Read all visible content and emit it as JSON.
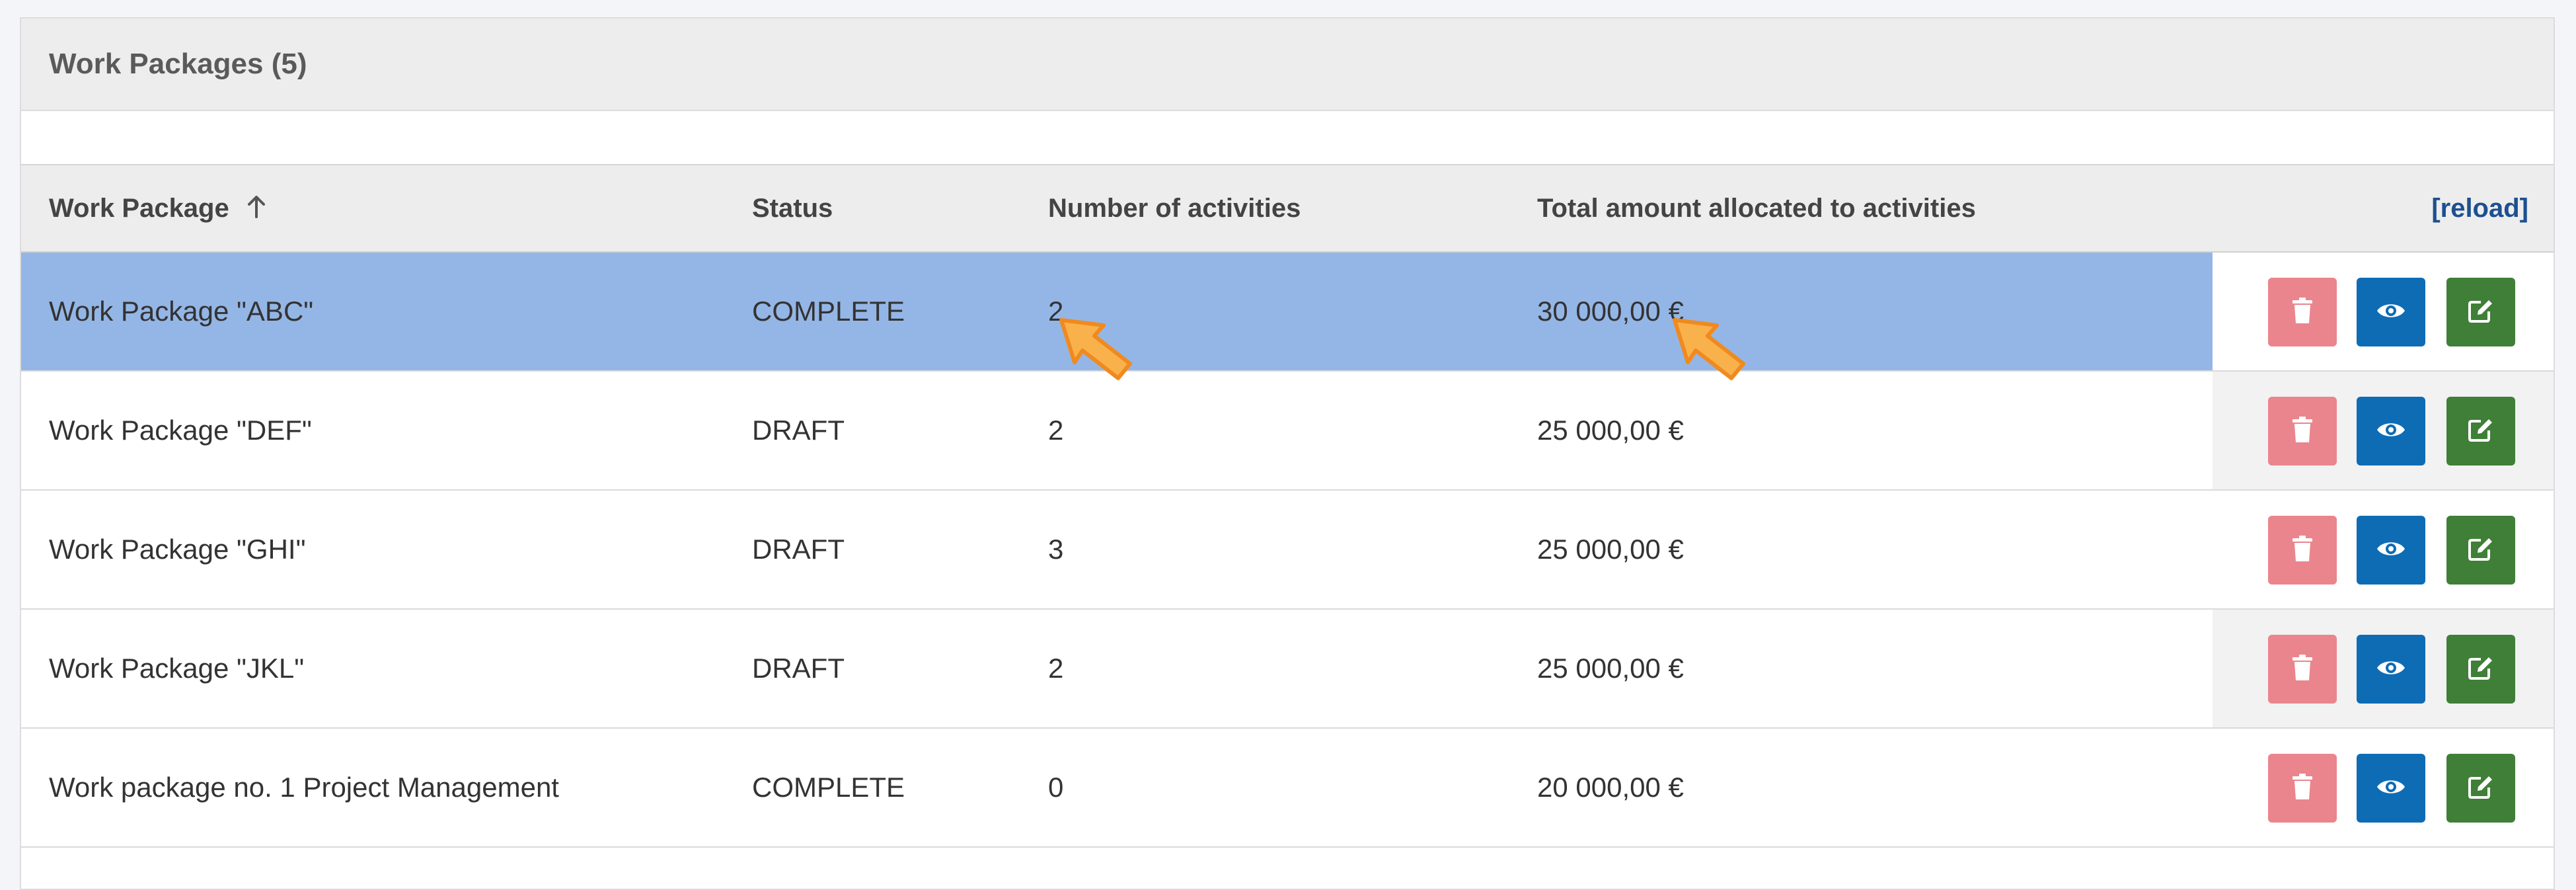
{
  "panel": {
    "title": "Work Packages (5)"
  },
  "table": {
    "headers": {
      "work_package": "Work Package",
      "status": "Status",
      "activities": "Number of activities",
      "amount": "Total amount allocated to activities"
    },
    "sort_icon": "arrow-up-icon",
    "reload_label": "[reload]",
    "rows": [
      {
        "name": "Work Package \"ABC\"",
        "status": "COMPLETE",
        "activities": "2",
        "amount": "30 000,00 €",
        "selected": true
      },
      {
        "name": "Work Package \"DEF\"",
        "status": "DRAFT",
        "activities": "2",
        "amount": "25 000,00 €",
        "selected": false
      },
      {
        "name": "Work Package \"GHI\"",
        "status": "DRAFT",
        "activities": "3",
        "amount": "25 000,00 €",
        "selected": false
      },
      {
        "name": "Work Package \"JKL\"",
        "status": "DRAFT",
        "activities": "2",
        "amount": "25 000,00 €",
        "selected": false
      },
      {
        "name": "Work package no. 1 Project Management",
        "status": "COMPLETE",
        "activities": "0",
        "amount": "20 000,00 €",
        "selected": false
      }
    ],
    "row_actions": [
      {
        "name": "delete-button",
        "icon": "trash-icon",
        "color": "#ea858e"
      },
      {
        "name": "view-button",
        "icon": "eye-icon",
        "color": "#0e6cb5"
      },
      {
        "name": "edit-button",
        "icon": "edit-icon",
        "color": "#3f7f37"
      }
    ]
  },
  "colors": {
    "selected_row": "#94b6e6",
    "reload_link": "#1d4f91",
    "highlight_arrow": "#f6a53a"
  }
}
